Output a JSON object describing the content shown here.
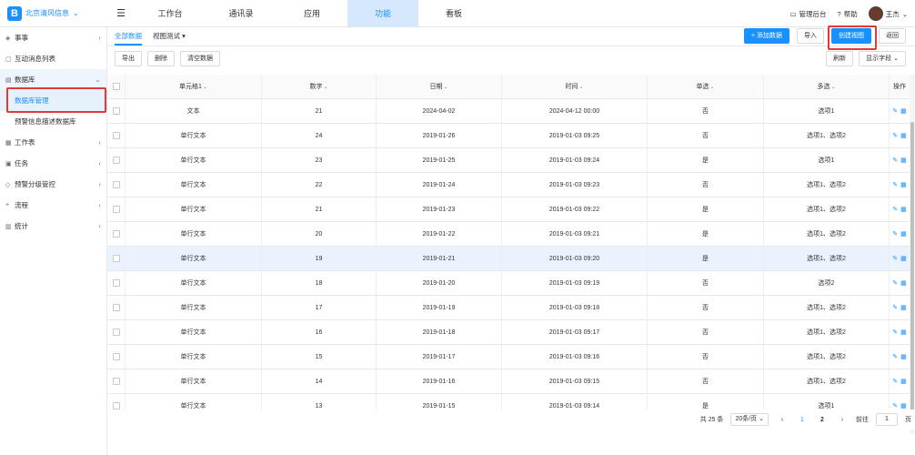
{
  "brand": {
    "logo": "B",
    "name": "北京清风信息"
  },
  "top_nav": [
    {
      "label": "工作台",
      "active": false
    },
    {
      "label": "通讯录",
      "active": false
    },
    {
      "label": "应用",
      "active": false
    },
    {
      "label": "功能",
      "active": true
    },
    {
      "label": "看板",
      "active": false
    }
  ],
  "top_right": {
    "admin": "管理后台",
    "help": "帮助",
    "user": "王杰"
  },
  "sidebar": {
    "items": [
      {
        "label": "事事",
        "icon": "layers-icon"
      },
      {
        "label": "互动消息列表",
        "icon": "message-icon"
      },
      {
        "label": "数据库",
        "icon": "database-icon"
      },
      {
        "label": "数据库管理",
        "icon": ""
      },
      {
        "label": "预警信息描述数据库",
        "icon": ""
      },
      {
        "label": "工作表",
        "icon": "sheet-icon"
      },
      {
        "label": "任务",
        "icon": "task-icon"
      },
      {
        "label": "预警分级管控",
        "icon": "bell-icon"
      },
      {
        "label": "流程",
        "icon": "flow-icon"
      },
      {
        "label": "统计",
        "icon": "chart-icon"
      }
    ]
  },
  "tabs": [
    {
      "label": "全部数据",
      "active": true
    },
    {
      "label": "视图测试",
      "active": false
    }
  ],
  "actions": {
    "add": "+ 添加数据",
    "import": "导入",
    "create_view": "创建视图",
    "back": "返回"
  },
  "toolbar": {
    "export": "导出",
    "delete": "删除",
    "clear": "清空数据",
    "refresh": "刷新",
    "show_fields": "显示字段"
  },
  "table": {
    "headers": [
      "单元格1",
      "数字",
      "日期",
      "时间",
      "单选",
      "多选",
      "操作"
    ],
    "rows": [
      [
        "文本",
        "21",
        "2024-04-02",
        "2024-04-12 00:00",
        "否",
        "选项1"
      ],
      [
        "单行文本",
        "24",
        "2019-01-26",
        "2019-01-03 09:25",
        "否",
        "选项1、选项2"
      ],
      [
        "单行文本",
        "23",
        "2019-01-25",
        "2019-01-03 09:24",
        "是",
        "选项1"
      ],
      [
        "单行文本",
        "22",
        "2019-01-24",
        "2019-01-03 09:23",
        "否",
        "选项1、选项2"
      ],
      [
        "单行文本",
        "21",
        "2019-01-23",
        "2019-01-03 09:22",
        "是",
        "选项1、选项2"
      ],
      [
        "单行文本",
        "20",
        "2019-01-22",
        "2019-01-03 09:21",
        "是",
        "选项1、选项2"
      ],
      [
        "单行文本",
        "19",
        "2019-01-21",
        "2019-01-03 09:20",
        "是",
        "选项1、选项2"
      ],
      [
        "单行文本",
        "18",
        "2019-01-20",
        "2019-01-03 09:19",
        "否",
        "选项2"
      ],
      [
        "单行文本",
        "17",
        "2019-01-19",
        "2019-01-03 09:18",
        "否",
        "选项1、选项2"
      ],
      [
        "单行文本",
        "16",
        "2019-01-18",
        "2019-01-03 09:17",
        "否",
        "选项1、选项2"
      ],
      [
        "单行文本",
        "15",
        "2019-01-17",
        "2019-01-03 09:16",
        "否",
        "选项1、选项2"
      ],
      [
        "单行文本",
        "14",
        "2019-01-16",
        "2019-01-03 09:15",
        "否",
        "选项1、选项2"
      ],
      [
        "单行文本",
        "13",
        "2019-01-15",
        "2019-01-03 09:14",
        "是",
        "选项1"
      ]
    ],
    "hover_row": 6
  },
  "pagination": {
    "total": "共 25 条",
    "page_size": "20条/页",
    "pages": [
      "1",
      "2"
    ],
    "current": "2",
    "goto": "前往",
    "goto_value": "1",
    "page_suffix": "页"
  },
  "colors": {
    "accent": "#1890ff",
    "highlight": "#e53935"
  }
}
